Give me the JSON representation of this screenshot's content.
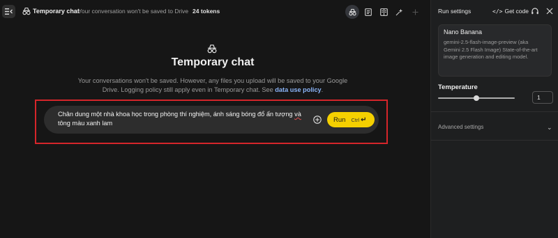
{
  "topbar": {
    "title": "Temporary chat",
    "subtitle": "Your conversation won't be saved to Drive",
    "tokens": "24 tokens"
  },
  "hero": {
    "title": "Temporary chat",
    "description": "Your conversations won't be saved. However, any files you upload will be saved to your Google Drive. Logging policy still apply even in Temporary chat. See ",
    "link_text": "data use policy",
    "description_end": "."
  },
  "prompt": {
    "text_before": "Chân dung một nhà khoa học trong phòng thí nghiệm, ánh sáng bóng đổ ấn tượng ",
    "text_flagged": "và",
    "text_after": " tông màu xanh lam",
    "run_label": "Run",
    "run_shortcut": "Ctrl"
  },
  "run_settings": {
    "title": "Run settings",
    "get_code": "Get code",
    "model": {
      "name": "Nano Banana",
      "description": "gemini-2.5-flash-image-preview (aka Gemini 2.5 Flash Image) State-of-the-art image generation and editing model."
    },
    "temperature_label": "Temperature",
    "temperature_value": "1",
    "temperature_level": 1.0,
    "temperature_max": 2.0,
    "advanced_settings": "Advanced settings"
  },
  "colors": {
    "background": "#161616",
    "panel": "#1e1f20",
    "run_button": "#f5d000",
    "link": "#8ab4f8",
    "highlight": "#d6252a"
  }
}
